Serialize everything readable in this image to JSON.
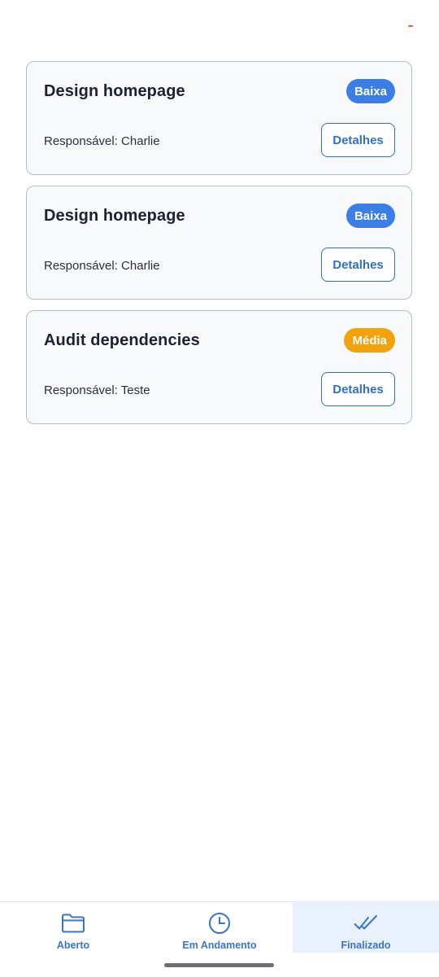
{
  "theme": {
    "accent": "#3a74c9",
    "badge_low": "#3b7fe6",
    "badge_medium": "#f2a20c",
    "status_dash": "#f25c3a"
  },
  "tasks": [
    {
      "title": "Design homepage",
      "priority": "Baixa",
      "priority_color": "#3b7fe6",
      "assignee": "Responsável: Charlie",
      "details_label": "Detalhes"
    },
    {
      "title": "Design homepage",
      "priority": "Baixa",
      "priority_color": "#3b7fe6",
      "assignee": "Responsável: Charlie",
      "details_label": "Detalhes"
    },
    {
      "title": "Audit dependencies",
      "priority": "Média",
      "priority_color": "#f2a20c",
      "assignee": "Responsável: Teste",
      "details_label": "Detalhes"
    }
  ],
  "nav": {
    "items": [
      {
        "label": "Aberto",
        "icon": "folder-icon",
        "active": false
      },
      {
        "label": "Em Andamento",
        "icon": "clock-icon",
        "active": false
      },
      {
        "label": "Finalizado",
        "icon": "double-check-icon",
        "active": true
      }
    ]
  }
}
